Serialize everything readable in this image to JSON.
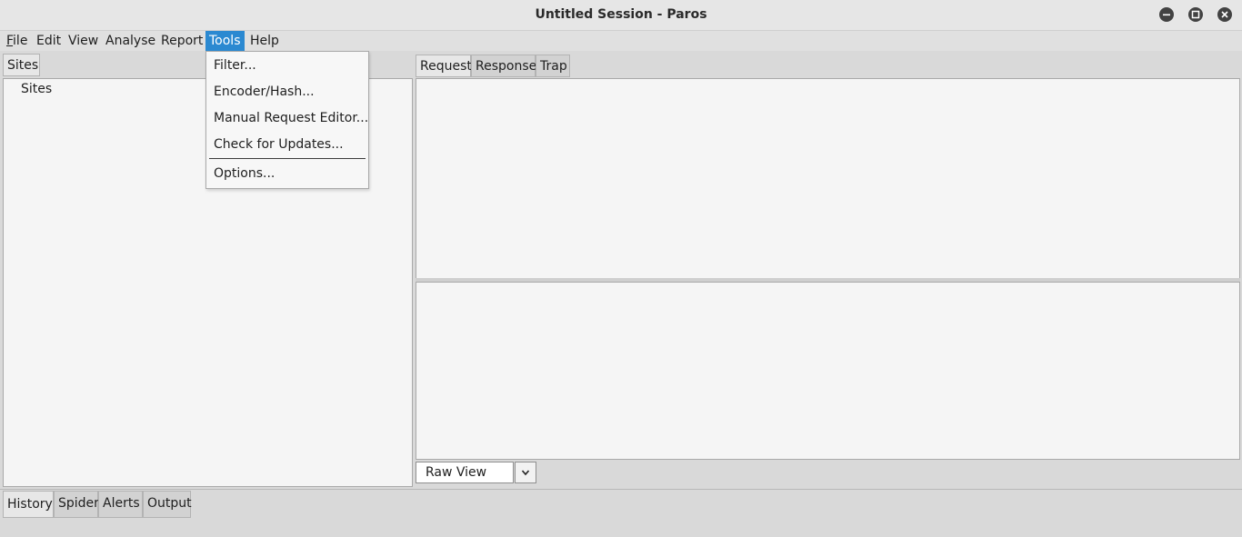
{
  "window": {
    "title": "Untitled Session - Paros",
    "controls": [
      "minimize-icon",
      "maximize-icon",
      "close-icon"
    ]
  },
  "menubar": {
    "items": [
      {
        "label": "File",
        "mnemonic": "F",
        "rest": "ile"
      },
      {
        "label": "Edit"
      },
      {
        "label": "View"
      },
      {
        "label": "Analyse"
      },
      {
        "label": "Report"
      },
      {
        "label": "Tools",
        "active": true
      },
      {
        "label": "Help"
      }
    ]
  },
  "tools_menu": {
    "items": [
      "Filter...",
      "Encoder/Hash...",
      "Manual Request Editor...",
      "Check for Updates...",
      "Options..."
    ]
  },
  "left_panel": {
    "tab": "Sites",
    "tree_root": "Sites"
  },
  "right_panel": {
    "tabs": [
      "Request",
      "Response",
      "Trap"
    ],
    "selected_tab": "Request",
    "view_select": {
      "value": "Raw View"
    }
  },
  "bottom_tabs": {
    "tabs": [
      "History",
      "Spider",
      "Alerts",
      "Output"
    ],
    "selected_tab": "History"
  },
  "colors": {
    "menu_highlight": "#2b89d1",
    "panel_bg": "#f5f5f5",
    "window_bg": "#d9d9d9"
  }
}
